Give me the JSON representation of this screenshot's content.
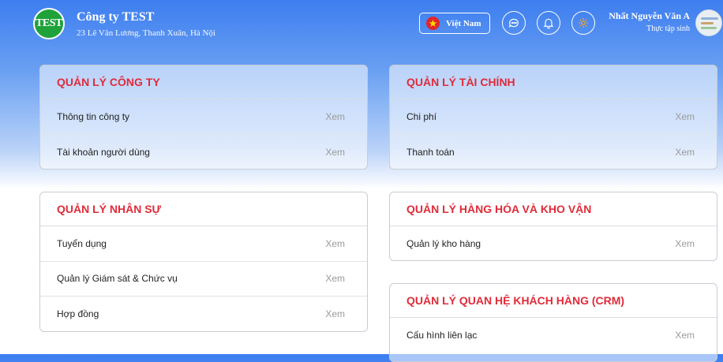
{
  "header": {
    "logo_text": "TEST",
    "company_name": "Công ty TEST",
    "company_address": "23 Lê Văn Lương, Thanh Xuân, Hà Nội",
    "language": "Việt Nam",
    "user_name": "Nhất Nguyễn Văn A",
    "user_role": "Thực tập sinh",
    "icons": [
      "chat-icon",
      "bell-icon",
      "settings-icon"
    ]
  },
  "sections": {
    "company": {
      "title": "QUẢN LÝ CÔNG TY",
      "items": [
        {
          "label": "Thông tin công ty",
          "action": "Xem"
        },
        {
          "label": "Tài khoản người dùng",
          "action": "Xem"
        }
      ]
    },
    "finance": {
      "title": "QUẢN LÝ TÀI CHÍNH",
      "items": [
        {
          "label": "Chi phí",
          "action": "Xem"
        },
        {
          "label": "Thanh toán",
          "action": "Xem"
        }
      ]
    },
    "hr": {
      "title": "QUẢN LÝ NHÂN SỰ",
      "items": [
        {
          "label": "Tuyển dụng",
          "action": "Xem"
        },
        {
          "label": "Quản lý Giám sát & Chức vụ",
          "action": "Xem"
        },
        {
          "label": "Hợp đồng",
          "action": "Xem"
        }
      ]
    },
    "goods": {
      "title": "QUẢN LÝ HÀNG HÓA VÀ KHO VẬN",
      "items": [
        {
          "label": "Quản lý kho hàng",
          "action": "Xem"
        }
      ]
    },
    "crm": {
      "title": "QUẢN LÝ QUAN HỆ KHÁCH HÀNG (CRM)",
      "items": [
        {
          "label": "Cấu hình liên lạc",
          "action": "Xem"
        }
      ]
    }
  },
  "colors": {
    "accent_title": "#e02b39",
    "header_blue": "#3d7ef0",
    "logo_green": "#1fa23a"
  }
}
